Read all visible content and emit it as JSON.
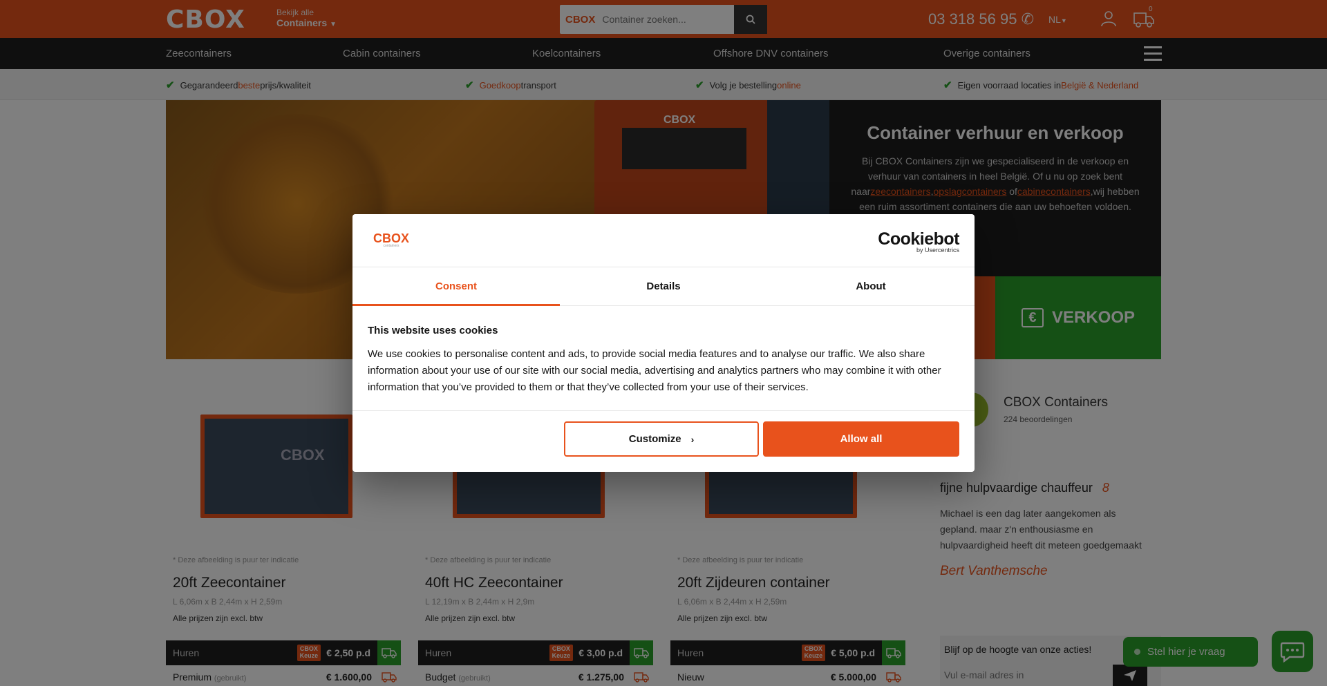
{
  "header": {
    "logo": "CBOX",
    "browse_small": "Bekijk alle",
    "browse_big": "Containers",
    "search_logo": "CBOX",
    "search_placeholder": "Container zoeken...",
    "phone": "03 318 56 95",
    "lang": "NL",
    "cart_count": "0"
  },
  "nav": {
    "items": [
      {
        "label": "Zeecontainers"
      },
      {
        "label": "Cabin containers"
      },
      {
        "label": "Koelcontainers"
      },
      {
        "label": "Offshore DNV containers"
      },
      {
        "label": "Overige containers"
      }
    ]
  },
  "usp": {
    "items": [
      {
        "pre": "Gegarandeerd ",
        "hl": "beste",
        "post": " prijs/kwaliteit"
      },
      {
        "pre": "",
        "hl": "Goedkoop",
        "post": " transport"
      },
      {
        "pre": "Volg je bestelling ",
        "hl": "online",
        "post": ""
      },
      {
        "pre": "Eigen voorraad locaties in ",
        "hl": "België & Nederland",
        "post": ""
      }
    ]
  },
  "hero": {
    "truck_label": "CBOX",
    "title": "Container verhuur en verkoop",
    "text_1": "Bij CBOX Containers zijn we gespecialiseerd in de verkoop en verhuur van containers in heel België. Of u nu op zoek bent naar",
    "link_1": "zeecontainers",
    "sep_1": ",",
    "link_2": "opslagcontainers",
    "sep_2": " of",
    "link_3": "cabinecontainers",
    "text_2": ",wij hebben een ruim assortiment containers die aan uw behoeften voldoen.",
    "verkoop_label": "VERKOOP",
    "euro_symbol": "€"
  },
  "products": [
    {
      "image_label": "CBOX",
      "note": "* Deze afbeelding is puur ter indicatie",
      "title": "20ft Zeecontainer",
      "dims": "L 6,06m x B 2,44m x H 2,59m",
      "vat": "Alle prijzen zijn excl. btw",
      "huur_label": "Huren",
      "badge_1": "CBOX",
      "badge_2": "Keuze",
      "huur_price": "€ 2,50 p.d",
      "buy_label": "Premium",
      "buy_sub": "(gebruikt)",
      "buy_price": "€ 1.600,00"
    },
    {
      "image_label": "",
      "note": "* Deze afbeelding is puur ter indicatie",
      "title": "40ft HC Zeecontainer",
      "dims": "L 12,19m x B 2,44m x H 2,9m",
      "vat": "Alle prijzen zijn excl. btw",
      "huur_label": "Huren",
      "badge_1": "CBOX",
      "badge_2": "Keuze",
      "huur_price": "€ 3,00 p.d",
      "buy_label": "Budget",
      "buy_sub": "(gebruikt)",
      "buy_price": "€ 1.275,00"
    },
    {
      "image_label": "",
      "note": "* Deze afbeelding is puur ter indicatie",
      "title": "20ft Zijdeuren container",
      "dims": "L 6,06m x B 2,44m x H 2,59m",
      "vat": "Alle prijzen zijn excl. btw",
      "huur_label": "Huren",
      "badge_1": "CBOX",
      "badge_2": "Keuze",
      "huur_price": "€ 5,00 p.d",
      "buy_label": "Nieuw",
      "buy_sub": "",
      "buy_price": "€ 5.000,00"
    }
  ],
  "review": {
    "name": "CBOX Containers",
    "count": "224 beoordelingen",
    "title": "fijne hulpvaardige chauffeur",
    "score": "8",
    "text": "Michael is een dag later aangekomen als gepland. maar z'n enthousiasme en hulpvaardigheid heeft dit meteen goedgemaakt",
    "author": "Bert Vanthemsche"
  },
  "newsletter": {
    "title": "Blijf op de hoogte van onze acties!",
    "placeholder": "Vul e-mail adres in"
  },
  "chat": {
    "label": "Stel hier je vraag"
  },
  "cookie": {
    "logo": "CBOX",
    "logo_sub": "containers",
    "provider": "Cookiebot",
    "provider_sub": "by Usercentrics",
    "tabs": [
      {
        "label": "Consent"
      },
      {
        "label": "Details"
      },
      {
        "label": "About"
      }
    ],
    "heading": "This website uses cookies",
    "body": "We use cookies to personalise content and ads, to provide social media features and to analyse our traffic. We also share information about your use of our site with our social media, advertising and analytics partners who may combine it with other information that you’ve provided to them or that they’ve collected from your use of their services.",
    "customize_label": "Customize",
    "allow_label": "Allow all"
  },
  "colors": {
    "brand": "#e8521c",
    "green": "#2aa02a",
    "dark": "#1e1e1e"
  }
}
